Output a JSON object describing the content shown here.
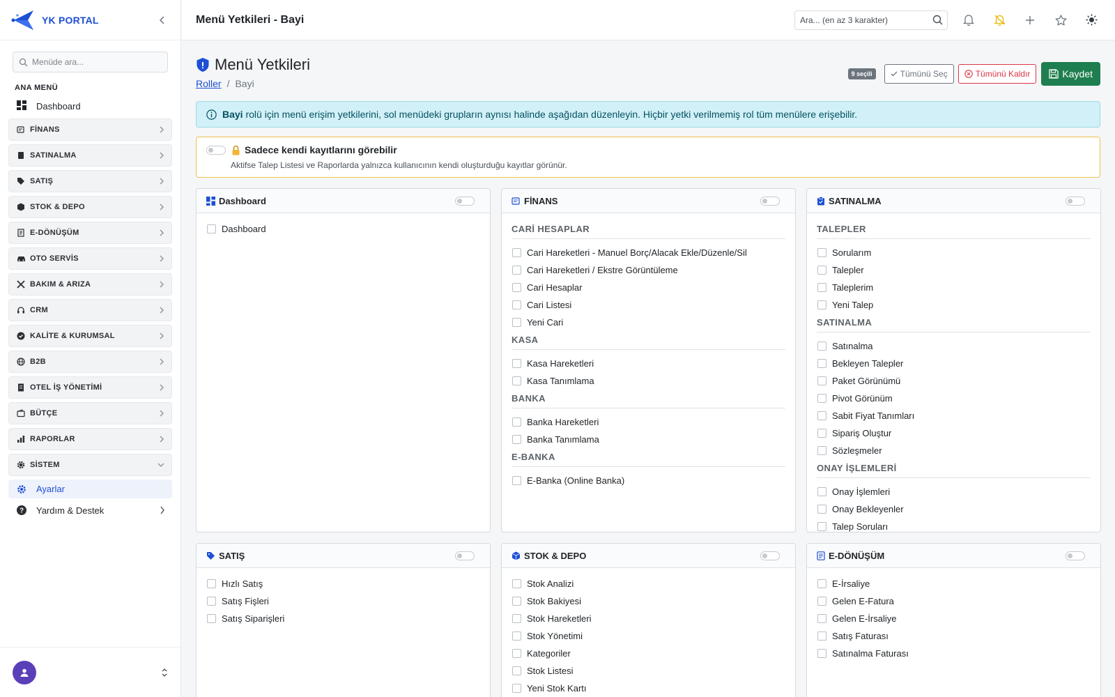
{
  "app": {
    "name": "YK PORTAL",
    "brand_color": "#1c4fd4"
  },
  "sidebar": {
    "search_placeholder": "Menüde ara...",
    "section_label": "ANA MENÜ",
    "dashboard_label": "Dashboard",
    "groups": [
      {
        "label": "FİNANS",
        "icon": "finance-icon"
      },
      {
        "label": "SATINALMA",
        "icon": "clipboard-icon"
      },
      {
        "label": "SATIŞ",
        "icon": "tag-icon"
      },
      {
        "label": "STOK & DEPO",
        "icon": "box-icon"
      },
      {
        "label": "E-DÖNÜŞÜM",
        "icon": "document-icon"
      },
      {
        "label": "OTO SERVİS",
        "icon": "car-icon"
      },
      {
        "label": "BAKIM & ARIZA",
        "icon": "tools-icon"
      },
      {
        "label": "CRM",
        "icon": "headset-icon"
      },
      {
        "label": "KALİTE & KURUMSAL",
        "icon": "badge-check-icon"
      },
      {
        "label": "B2B",
        "icon": "globe-icon"
      },
      {
        "label": "OTEL İŞ YÖNETİMİ",
        "icon": "building-icon"
      },
      {
        "label": "BÜTÇE",
        "icon": "wallet-icon"
      },
      {
        "label": "RAPORLAR",
        "icon": "bar-chart-icon"
      },
      {
        "label": "SİSTEM",
        "icon": "gear-icon"
      }
    ],
    "active_sub": "Ayarlar",
    "help_label": "Yardım & Destek"
  },
  "topbar": {
    "title": "Menü Yetkileri - Bayi",
    "search_placeholder": "Ara... (en az 3 karakter)"
  },
  "page": {
    "title": "Menü Yetkileri",
    "breadcrumb": {
      "parent": "Roller",
      "separator": "/",
      "current": "Bayi"
    },
    "selected_badge": "9 seçili",
    "select_all": "Tümünü Seç",
    "remove_all": "Tümünü Kaldır",
    "save": "Kaydet",
    "info_role": "Bayi",
    "info_text": "rolü için menü erişim yetkilerini, sol menüdeki grupların aynısı halinde aşağıdan düzenleyin. Hiçbir yetki verilmemiş rol tüm menülere erişebilir.",
    "own_records_title": "Sadece kendi kayıtlarını görebilir",
    "own_records_desc": "Aktifse Talep Listesi ve Raporlarda yalnızca kullanıcının kendi oluşturduğu kayıtlar görünür."
  },
  "cards": {
    "dashboard": {
      "title": "Dashboard",
      "items": [
        "Dashboard"
      ]
    },
    "finans": {
      "title": "FİNANS",
      "sections": [
        {
          "title": "CARİ HESAPLAR",
          "items": [
            "Cari Hareketleri - Manuel Borç/Alacak Ekle/Düzenle/Sil",
            "Cari Hareketleri / Ekstre Görüntüleme",
            "Cari Hesaplar",
            "Cari Listesi",
            "Yeni Cari"
          ]
        },
        {
          "title": "KASA",
          "items": [
            "Kasa Hareketleri",
            "Kasa Tanımlama"
          ]
        },
        {
          "title": "BANKA",
          "items": [
            "Banka Hareketleri",
            "Banka Tanımlama"
          ]
        },
        {
          "title": "E-BANKA",
          "items": [
            "E-Banka (Online Banka)"
          ]
        }
      ]
    },
    "satinalma": {
      "title": "SATINALMA",
      "sections": [
        {
          "title": "TALEPLER",
          "items": [
            "Sorularım",
            "Talepler",
            "Taleplerim",
            "Yeni Talep"
          ]
        },
        {
          "title": "SATINALMA",
          "items": [
            "Satınalma",
            "Bekleyen Talepler",
            "Paket Görünümü",
            "Pivot Görünüm",
            "Sabit Fiyat Tanımları",
            "Sipariş Oluştur",
            "Sözleşmeler"
          ]
        },
        {
          "title": "ONAY İŞLEMLERİ",
          "items": [
            "Onay İşlemleri",
            "Onay Bekleyenler",
            "Talep Soruları"
          ]
        }
      ]
    },
    "satis": {
      "title": "SATIŞ",
      "items": [
        "Hızlı Satış",
        "Satış Fişleri",
        "Satış Siparişleri"
      ]
    },
    "stok": {
      "title": "STOK & DEPO",
      "items": [
        "Stok Analizi",
        "Stok Bakiyesi",
        "Stok Hareketleri",
        "Stok Yönetimi",
        "Kategoriler",
        "Stok Listesi",
        "Yeni Stok Kartı"
      ]
    },
    "edonusum": {
      "title": "E-DÖNÜŞÜM",
      "items": [
        "E-İrsaliye",
        "Gelen E-Fatura",
        "Gelen E-İrsaliye",
        "Satış Faturası",
        "Satınalma Faturası"
      ]
    }
  }
}
